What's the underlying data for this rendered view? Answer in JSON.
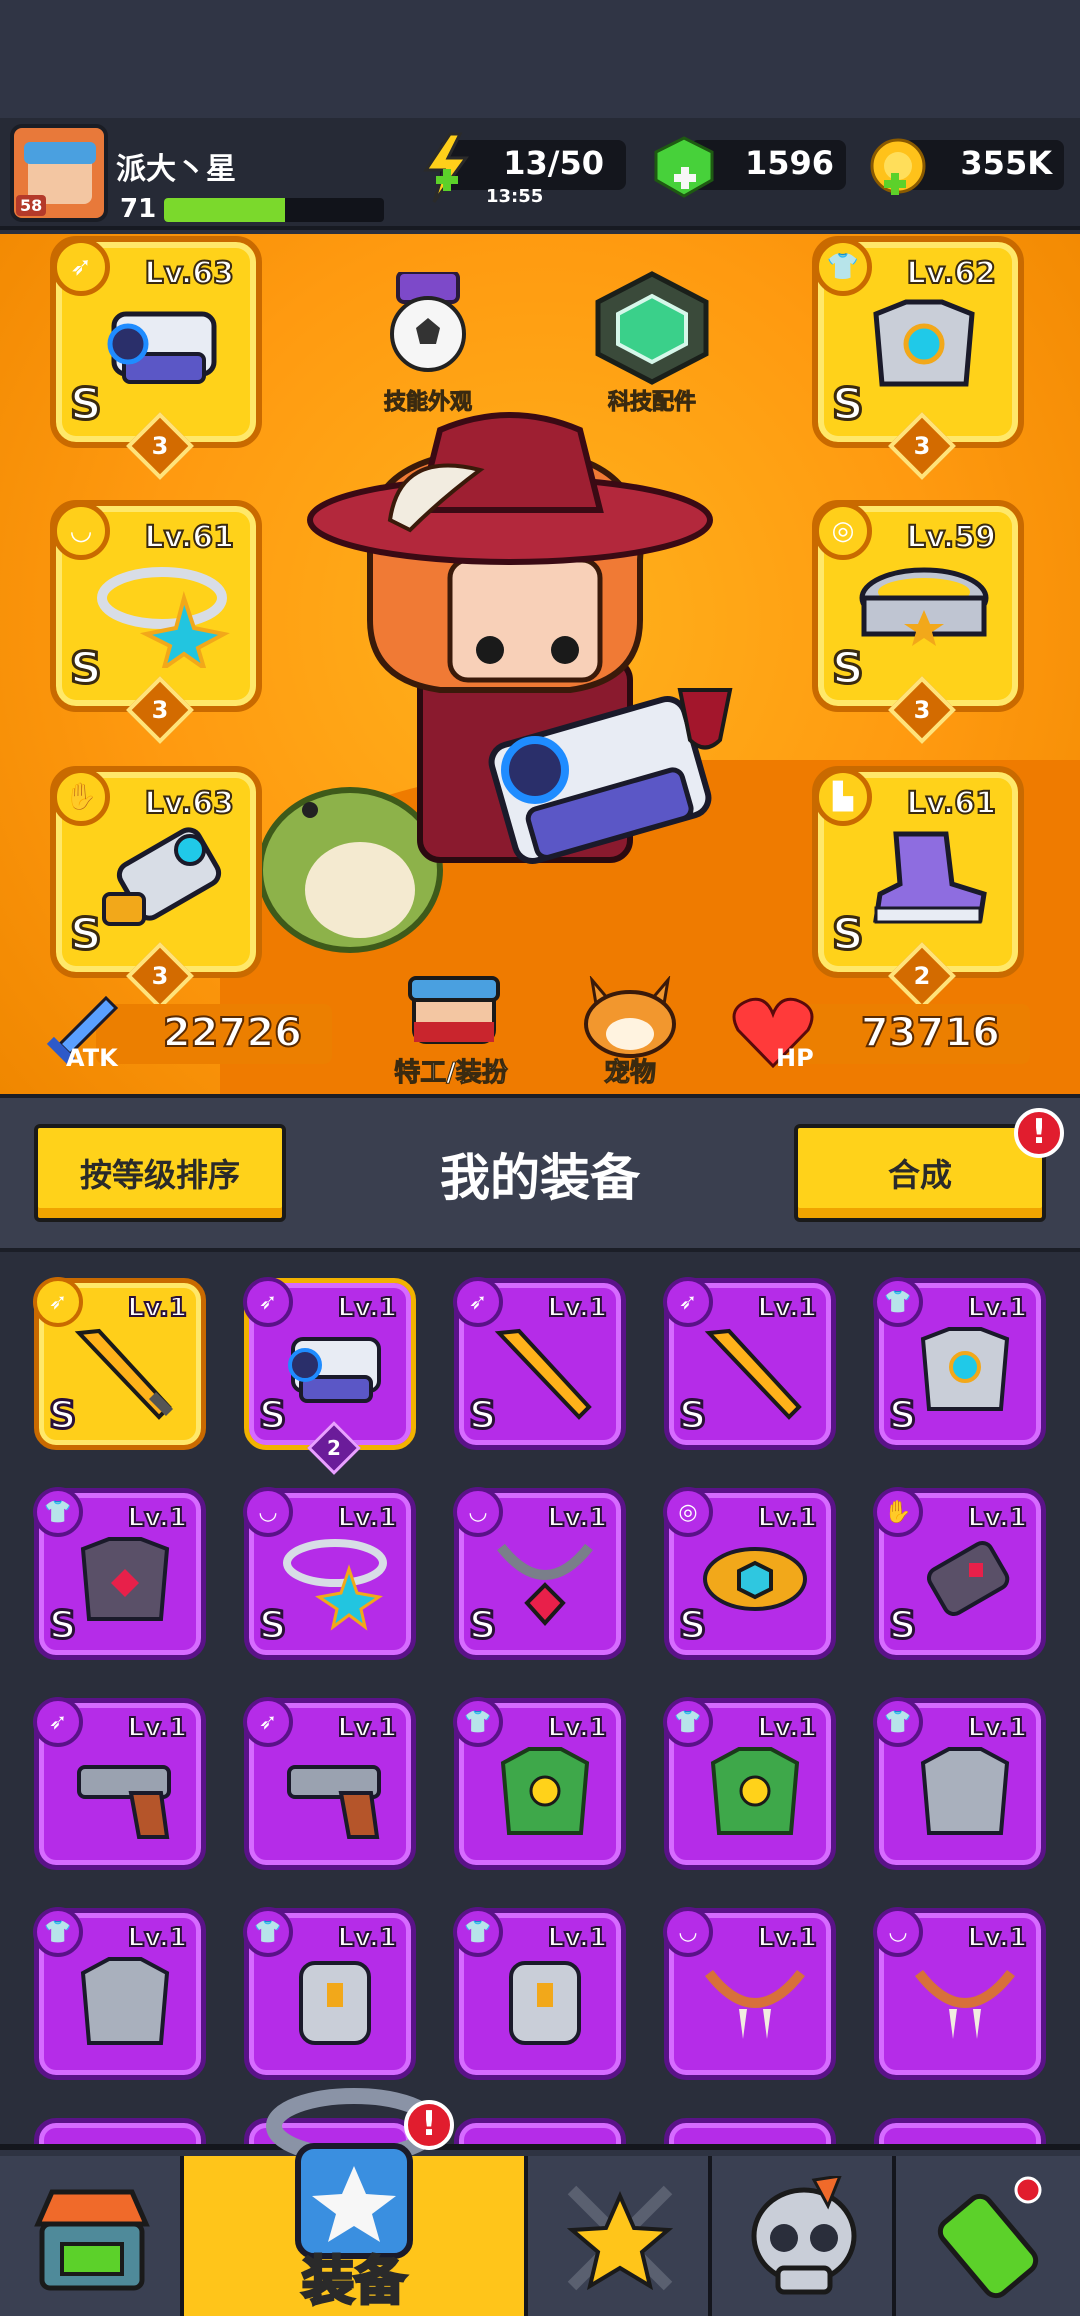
{
  "player": {
    "name": "派大丶星",
    "level": "71",
    "avatar_badge": "58",
    "xp_fraction": 0.55
  },
  "resources": {
    "energy": "13/50",
    "energy_timer": "13:55",
    "gems": "1596",
    "coins": "355K"
  },
  "hero_center": {
    "skill_skin": "技能外观",
    "tech_parts": "科技配件",
    "agent": "特工/装扮",
    "pet": "宠物"
  },
  "stats": {
    "atk_label": "ATK",
    "atk": "22726",
    "hp_label": "HP",
    "hp": "73716"
  },
  "equipped": [
    {
      "lv": "Lv.63",
      "rank": "S",
      "stars": "3",
      "cat": "weapon"
    },
    {
      "lv": "Lv.62",
      "rank": "S",
      "stars": "3",
      "cat": "armor"
    },
    {
      "lv": "Lv.61",
      "rank": "S",
      "stars": "3",
      "cat": "necklace"
    },
    {
      "lv": "Lv.59",
      "rank": "S",
      "stars": "3",
      "cat": "belt"
    },
    {
      "lv": "Lv.63",
      "rank": "S",
      "stars": "3",
      "cat": "glove"
    },
    {
      "lv": "Lv.61",
      "rank": "S",
      "stars": "2",
      "cat": "boots"
    }
  ],
  "bar": {
    "sort": "按等级排序",
    "title": "我的装备",
    "merge": "合成",
    "merge_alert": "!"
  },
  "inventory": [
    {
      "lv": "Lv.1",
      "rank": "S"
    },
    {
      "lv": "Lv.1",
      "rank": "S",
      "count": "2"
    },
    {
      "lv": "Lv.1",
      "rank": "S"
    },
    {
      "lv": "Lv.1",
      "rank": "S"
    },
    {
      "lv": "Lv.1",
      "rank": "S"
    },
    {
      "lv": "Lv.1",
      "rank": "S"
    },
    {
      "lv": "Lv.1",
      "rank": "S"
    },
    {
      "lv": "Lv.1",
      "rank": "S"
    },
    {
      "lv": "Lv.1",
      "rank": "S"
    },
    {
      "lv": "Lv.1",
      "rank": "S"
    },
    {
      "lv": "Lv.1"
    },
    {
      "lv": "Lv.1"
    },
    {
      "lv": "Lv.1"
    },
    {
      "lv": "Lv.1"
    },
    {
      "lv": "Lv.1"
    },
    {
      "lv": "Lv.1"
    },
    {
      "lv": "Lv.1"
    },
    {
      "lv": "Lv.1"
    },
    {
      "lv": "Lv.1"
    },
    {
      "lv": "Lv.1"
    }
  ],
  "nav": {
    "equip": "装备",
    "equip_alert": "!"
  },
  "colors": {
    "hero_orange": "#ff9a10",
    "slot_gold": "#ffd21a",
    "epic_purple": "#b52ce8",
    "alert_red": "#e11d2e"
  }
}
